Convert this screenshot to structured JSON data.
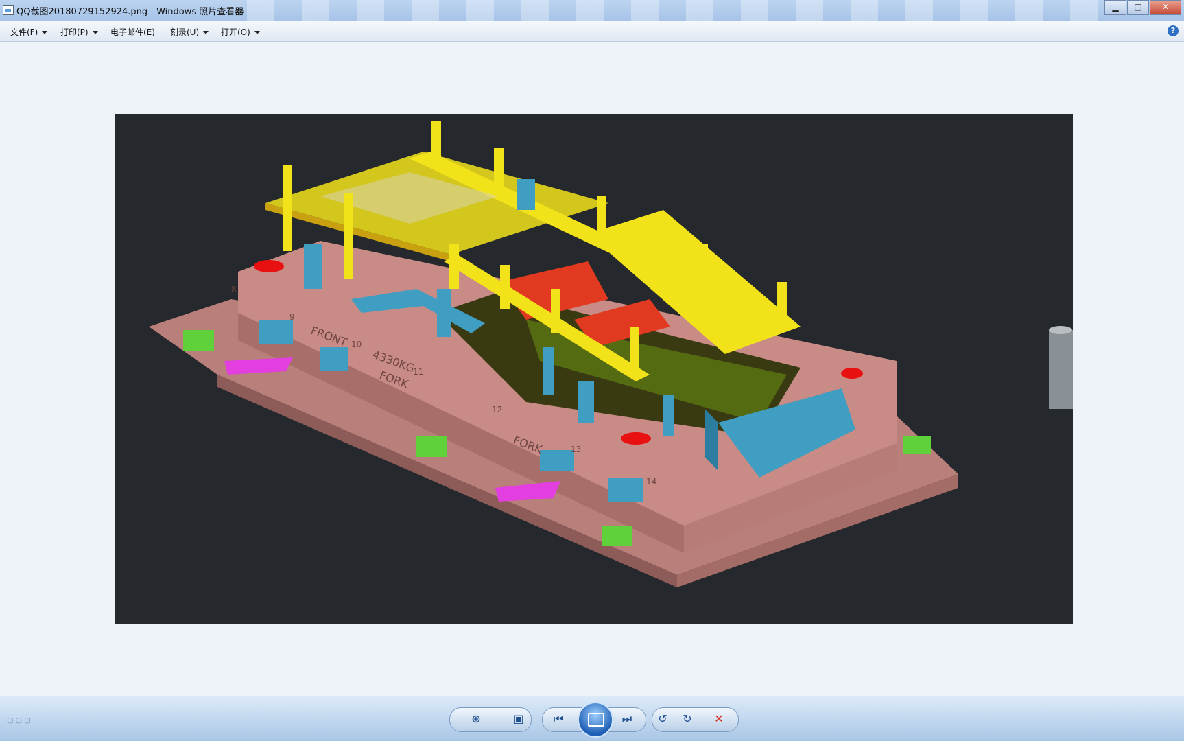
{
  "window": {
    "title": "QQ截图20180729152924.png - Windows 照片查看器",
    "minimize_symbol": "▁",
    "maximize_symbol": "□",
    "close_symbol": "✕"
  },
  "menu": {
    "items": [
      {
        "label": "文件(F)"
      },
      {
        "label": "打印(P)"
      },
      {
        "label": "电子邮件(E)"
      },
      {
        "label": "刻录(U)"
      },
      {
        "label": "打开(O)"
      }
    ],
    "help_symbol": "?"
  },
  "image": {
    "description_icon": "cad-die-assembly-render",
    "annotations": [
      "FRONT",
      "4330KG",
      "FORK",
      "FORK",
      "8",
      "9",
      "10",
      "11",
      "12",
      "13",
      "14"
    ]
  },
  "toolbar": {
    "zoom_icon": "zoom-icon",
    "fit_icon": "actual-size-icon",
    "prev_icon": "previous-icon",
    "slideshow_icon": "slideshow-icon",
    "next_icon": "next-icon",
    "rotate_ccw_icon": "rotate-ccw-icon",
    "rotate_cw_icon": "rotate-cw-icon",
    "delete_icon": "delete-icon"
  },
  "colors": {
    "background_dark": "#25282c",
    "die_body": "#c98b86",
    "yellow": "#f2e21a",
    "blue": "#3f9ec2",
    "green": "#5fd13a",
    "magenta": "#e23ee0",
    "red": "#e23a20"
  }
}
